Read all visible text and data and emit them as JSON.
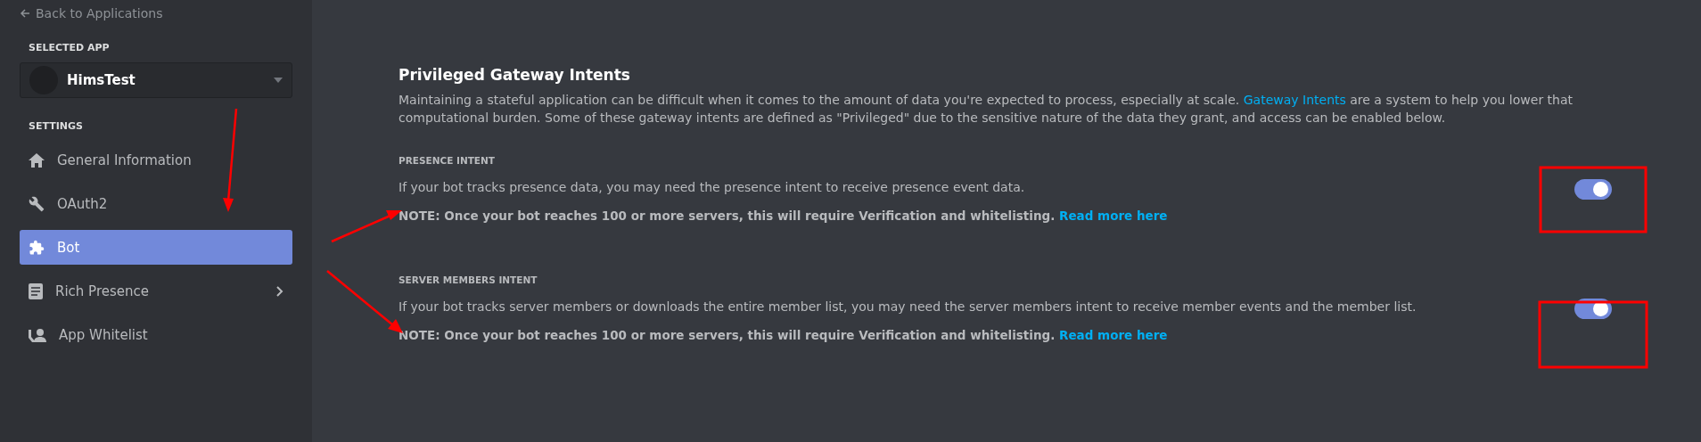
{
  "sidebar": {
    "back_link": "Back to Applications",
    "selected_app_heading": "SELECTED APP",
    "selected_app": {
      "name": "HimsTest"
    },
    "settings_heading": "SETTINGS",
    "items": [
      {
        "label": "General Information",
        "kind": "home",
        "selected": false,
        "has_submenu": false
      },
      {
        "label": "OAuth2",
        "kind": "wrench",
        "selected": false,
        "has_submenu": false
      },
      {
        "label": "Bot",
        "kind": "puzzle",
        "selected": true,
        "has_submenu": false
      },
      {
        "label": "Rich Presence",
        "kind": "document",
        "selected": false,
        "has_submenu": true
      },
      {
        "label": "App Whitelist",
        "kind": "person",
        "selected": false,
        "has_submenu": false
      }
    ]
  },
  "main": {
    "title": "Privileged Gateway Intents",
    "description_before_link": "Maintaining a stateful application can be difficult when it comes to the amount of data you're expected to process, especially at scale.",
    "description_link": "Gateway Intents",
    "description_after_link": "are a system to help you lower that computational burden. Some of these gateway intents are defined as \"Privileged\" due to the sensitive nature of the data they grant, and access can be enabled below.",
    "intents": [
      {
        "heading": "PRESENCE INTENT",
        "description": "If your bot tracks presence data, you may need the presence intent to receive presence event data.",
        "note": "NOTE: Once your bot reaches 100 or more servers, this will require Verification and whitelisting.",
        "link": "Read more here",
        "on": true
      },
      {
        "heading": "SERVER MEMBERS INTENT",
        "description": "If your bot tracks server members or downloads the entire member list, you may need the server members intent to receive member events and the member list.",
        "note": "NOTE: Once your bot reaches 100 or more servers, this will require Verification and whitelisting.",
        "link": "Read more here",
        "on": true
      }
    ]
  }
}
